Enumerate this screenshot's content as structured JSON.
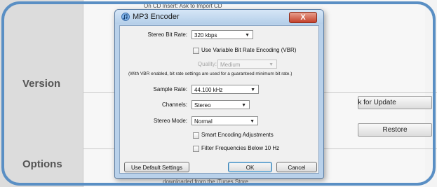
{
  "background": {
    "top_text": "On CD Insert:   Ask to Import CD",
    "sections": [
      "Version",
      "Options"
    ],
    "buttons": {
      "check_update": "Check for Update",
      "restore": "Restore"
    },
    "bottom_text": "downloaded from the iTunes Store."
  },
  "dialog": {
    "title": "MP3 Encoder",
    "close_label": "X",
    "stereo_bit_rate": {
      "label": "Stereo Bit Rate:",
      "value": "320 kbps"
    },
    "vbr": {
      "label": "Use Variable Bit Rate Encoding (VBR)",
      "checked": false
    },
    "quality": {
      "label": "Quality:",
      "value": "Medium"
    },
    "vbr_note": "(With VBR enabled, bit rate settings are used for a guaranteed minimum bit rate.)",
    "sample_rate": {
      "label": "Sample Rate:",
      "value": "44.100 kHz"
    },
    "channels": {
      "label": "Channels:",
      "value": "Stereo"
    },
    "stereo_mode": {
      "label": "Stereo Mode:",
      "value": "Normal"
    },
    "smart_encoding": {
      "label": "Smart Encoding Adjustments",
      "checked": false
    },
    "filter": {
      "label": "Filter Frequencies Below 10 Hz",
      "checked": false
    },
    "buttons": {
      "defaults": "Use Default Settings",
      "ok": "OK",
      "cancel": "Cancel"
    }
  },
  "colors": {
    "frame": "#5a8fc4",
    "titlebar": "#b9d1ea",
    "close": "#c4402a"
  },
  "icons": {
    "app": "itunes-note-icon",
    "dropdown": "chevron-down-icon"
  }
}
